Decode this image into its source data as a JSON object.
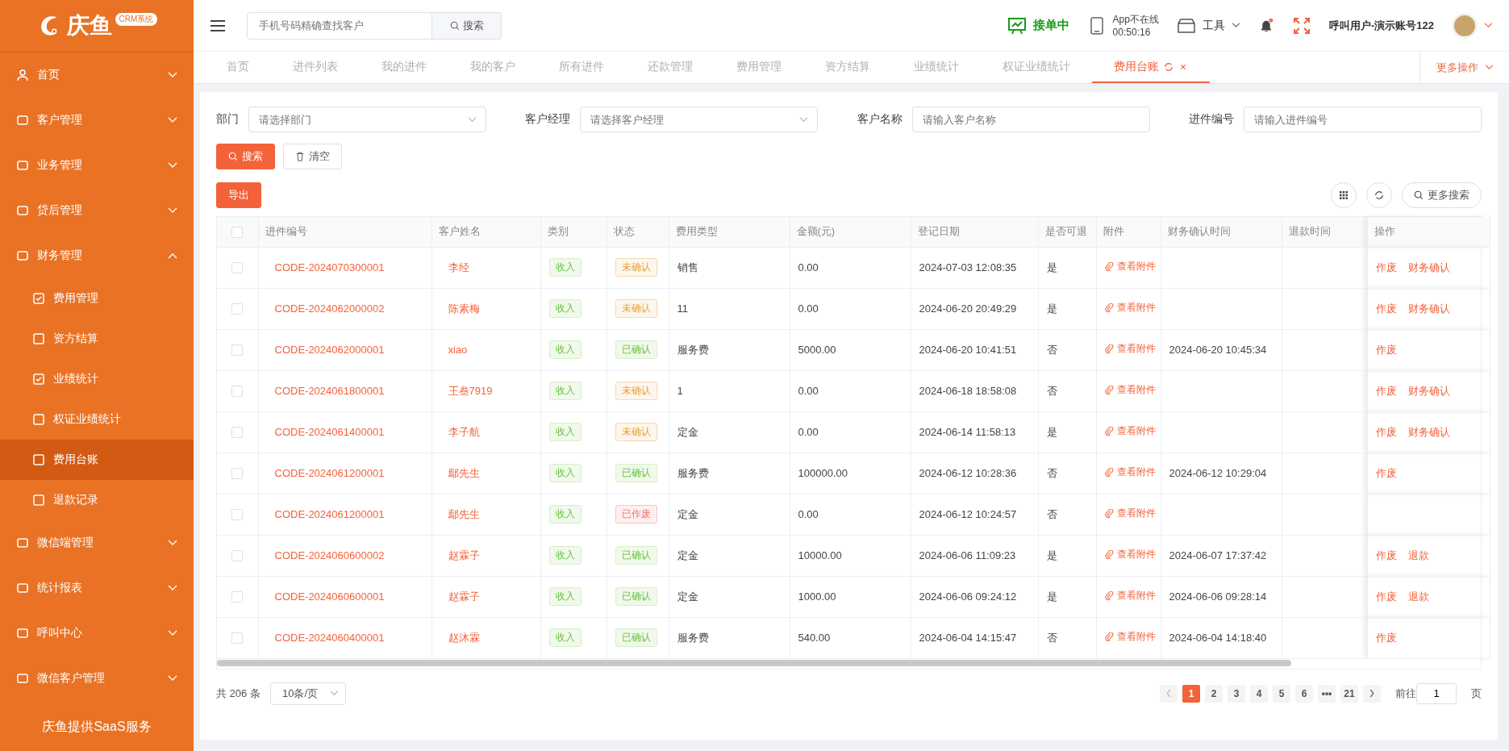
{
  "logo": {
    "name": "庆鱼",
    "badge": "CRM系统"
  },
  "sidebar": {
    "items": [
      {
        "label": "首页",
        "expanded": false
      },
      {
        "label": "客户管理",
        "expanded": false
      },
      {
        "label": "业务管理",
        "expanded": false
      },
      {
        "label": "贷后管理",
        "expanded": false
      },
      {
        "label": "财务管理",
        "expanded": true,
        "children": [
          {
            "label": "费用管理",
            "selected": false
          },
          {
            "label": "资方结算",
            "selected": false
          },
          {
            "label": "业绩统计",
            "selected": false
          },
          {
            "label": "权证业绩统计",
            "selected": false
          },
          {
            "label": "费用台账",
            "selected": true
          },
          {
            "label": "退款记录",
            "selected": false
          }
        ]
      },
      {
        "label": "微信端管理",
        "expanded": false
      },
      {
        "label": "统计报表",
        "expanded": false
      },
      {
        "label": "呼叫中心",
        "expanded": false
      },
      {
        "label": "微信客户管理",
        "expanded": false
      }
    ],
    "footer": "庆鱼提供SaaS服务"
  },
  "header": {
    "search_placeholder": "手机号码精确查找客户",
    "search_button": "搜索",
    "order_status": "接单中",
    "app_status": "App不在线",
    "app_time": "00:50:16",
    "tools": "工具",
    "user": "呼叫用户-演示账号122"
  },
  "tabs": [
    {
      "label": "首页",
      "selected": false
    },
    {
      "label": "进件列表",
      "selected": false
    },
    {
      "label": "我的进件",
      "selected": false
    },
    {
      "label": "我的客户",
      "selected": false
    },
    {
      "label": "所有进件",
      "selected": false
    },
    {
      "label": "还款管理",
      "selected": false
    },
    {
      "label": "费用管理",
      "selected": false
    },
    {
      "label": "资方结算",
      "selected": false
    },
    {
      "label": "业绩统计",
      "selected": false
    },
    {
      "label": "权证业绩统计",
      "selected": false
    },
    {
      "label": "费用台账",
      "selected": true
    }
  ],
  "more_actions": "更多操作",
  "filters": [
    {
      "label": "部门",
      "placeholder": "请选择部门",
      "kind": "select"
    },
    {
      "label": "客户经理",
      "placeholder": "请选择客户经理",
      "kind": "select"
    },
    {
      "label": "客户名称",
      "placeholder": "请输入客户名称",
      "kind": "input"
    },
    {
      "label": "进件编号",
      "placeholder": "请输入进件编号",
      "kind": "input"
    }
  ],
  "buttons": {
    "search": "搜索",
    "clear": "清空",
    "export": "导出",
    "more_search": "更多搜索"
  },
  "table": {
    "select_all": {
      "checked": false
    },
    "columns": [
      "进件编号",
      "客户姓名",
      "类别",
      "状态",
      "费用类型",
      "金额(元)",
      "登记日期",
      "是否可退",
      "附件",
      "财务确认时间",
      "退款时间",
      "操作"
    ],
    "rows": [
      {
        "checked": false,
        "code": "CODE-2024070300001",
        "name": "李经",
        "category": "收入",
        "status": "未确认",
        "kind": "pending",
        "fee_type": "销售",
        "amount": "0.00",
        "date": "2024-07-03 12:08:35",
        "refundable": "是",
        "attachment": "查看附件",
        "confirm_time": "",
        "actions": [
          "作废",
          "财务确认"
        ]
      },
      {
        "checked": false,
        "code": "CODE-2024062000002",
        "name": "陈素梅",
        "category": "收入",
        "status": "未确认",
        "kind": "pending",
        "fee_type": "11",
        "amount": "0.00",
        "date": "2024-06-20 20:49:29",
        "refundable": "是",
        "attachment": "查看附件",
        "confirm_time": "",
        "actions": [
          "作废",
          "财务确认"
        ]
      },
      {
        "checked": false,
        "code": "CODE-2024062000001",
        "name": "xiao",
        "category": "收入",
        "status": "已确认",
        "kind": "confirmed",
        "fee_type": "服务费",
        "amount": "5000.00",
        "date": "2024-06-20 10:41:51",
        "refundable": "否",
        "attachment": "查看附件",
        "confirm_time": "2024-06-20 10:45:34",
        "actions": [
          "作废"
        ]
      },
      {
        "checked": false,
        "code": "CODE-2024061800001",
        "name": "王叁7919",
        "category": "收入",
        "status": "未确认",
        "kind": "pending",
        "fee_type": "1",
        "amount": "0.00",
        "date": "2024-06-18 18:58:08",
        "refundable": "否",
        "attachment": "查看附件",
        "confirm_time": "",
        "actions": [
          "作废",
          "财务确认"
        ]
      },
      {
        "checked": false,
        "code": "CODE-2024061400001",
        "name": "李子航",
        "category": "收入",
        "status": "未确认",
        "kind": "pending",
        "fee_type": "定金",
        "amount": "0.00",
        "date": "2024-06-14 11:58:13",
        "refundable": "是",
        "attachment": "查看附件",
        "confirm_time": "",
        "actions": [
          "作废",
          "财务确认"
        ]
      },
      {
        "checked": false,
        "code": "CODE-2024061200001",
        "name": "鄢先生",
        "category": "收入",
        "status": "已确认",
        "kind": "confirmed",
        "fee_type": "服务费",
        "amount": "100000.00",
        "date": "2024-06-12 10:28:36",
        "refundable": "否",
        "attachment": "查看附件",
        "confirm_time": "2024-06-12 10:29:04",
        "actions": [
          "作废"
        ]
      },
      {
        "checked": false,
        "code": "CODE-2024061200001",
        "name": "鄢先生",
        "category": "收入",
        "status": "已作废",
        "kind": "void",
        "fee_type": "定金",
        "amount": "0.00",
        "date": "2024-06-12 10:24:57",
        "refundable": "否",
        "attachment": "查看附件",
        "confirm_time": "",
        "actions": []
      },
      {
        "checked": false,
        "code": "CODE-2024060600002",
        "name": "赵霖子",
        "category": "收入",
        "status": "已确认",
        "kind": "confirmed",
        "fee_type": "定金",
        "amount": "10000.00",
        "date": "2024-06-06 11:09:23",
        "refundable": "是",
        "attachment": "查看附件",
        "confirm_time": "2024-06-07 17:37:42",
        "actions": [
          "作废",
          "退款"
        ]
      },
      {
        "checked": false,
        "code": "CODE-2024060600001",
        "name": "赵霖子",
        "category": "收入",
        "status": "已确认",
        "kind": "confirmed",
        "fee_type": "定金",
        "amount": "1000.00",
        "date": "2024-06-06 09:24:12",
        "refundable": "是",
        "attachment": "查看附件",
        "confirm_time": "2024-06-06 09:28:14",
        "actions": [
          "作废",
          "退款"
        ]
      },
      {
        "checked": false,
        "code": "CODE-2024060400001",
        "name": "赵沐霖",
        "category": "收入",
        "status": "已确认",
        "kind": "confirmed",
        "fee_type": "服务费",
        "amount": "540.00",
        "date": "2024-06-04 14:15:47",
        "refundable": "否",
        "attachment": "查看附件",
        "confirm_time": "2024-06-04 14:18:40",
        "actions": [
          "作废"
        ]
      }
    ]
  },
  "pagination": {
    "total": "共 206 条",
    "page_size": "10条/页",
    "pages": [
      {
        "label": "1",
        "selected": true
      },
      {
        "label": "2",
        "selected": false
      },
      {
        "label": "3",
        "selected": false
      },
      {
        "label": "4",
        "selected": false
      },
      {
        "label": "5",
        "selected": false
      },
      {
        "label": "6",
        "selected": false
      },
      {
        "label": "•••",
        "selected": false
      },
      {
        "label": "21",
        "selected": false
      }
    ],
    "goto_label": "前往",
    "goto_value": "1",
    "goto_suffix": "页"
  }
}
